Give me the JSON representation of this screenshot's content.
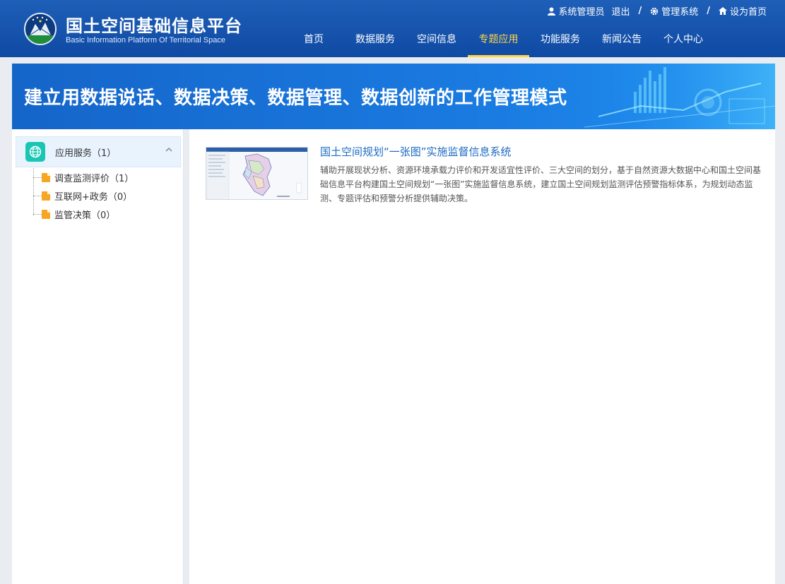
{
  "header": {
    "title_cn": "国土空间基础信息平台",
    "title_en": "Basic Information  Platform Of Territorial Space",
    "user": "系统管理员",
    "logout": "退出",
    "separator": "/",
    "admin": "管理系统",
    "homepage": "设为首页",
    "colors": {
      "bg": "#1a56b0",
      "active": "#ffd54a"
    }
  },
  "nav": {
    "items": [
      {
        "label": "首页"
      },
      {
        "label": "数据服务"
      },
      {
        "label": "空间信息"
      },
      {
        "label": "专题应用"
      },
      {
        "label": "功能服务"
      },
      {
        "label": "新闻公告"
      },
      {
        "label": "个人中心"
      }
    ],
    "active_index": 3
  },
  "banner": {
    "text": "建立用数据说话、数据决策、数据管理、数据创新的工作管理模式"
  },
  "sidebar": {
    "root": {
      "label": "应用服务（1）",
      "icon": "globe-icon"
    },
    "children": [
      {
        "label": "调查监测评价（1）"
      },
      {
        "label": "互联网+政务（0）"
      },
      {
        "label": "监管决策（0）"
      }
    ]
  },
  "main": {
    "items": [
      {
        "title": "国土空间规划“一张图”实施监督信息系统",
        "desc": "辅助开展现状分析、资源环境承载力评价和开发适宜性评价、三大空间的划分，基于自然资源大数据中心和国土空间基础信息平台构建国土空间规划“一张图”实施监督信息系统，建立国土空间规划监测评估预警指标体系，为规划动态监测、专题评估和预警分析提供辅助决策。"
      }
    ]
  }
}
